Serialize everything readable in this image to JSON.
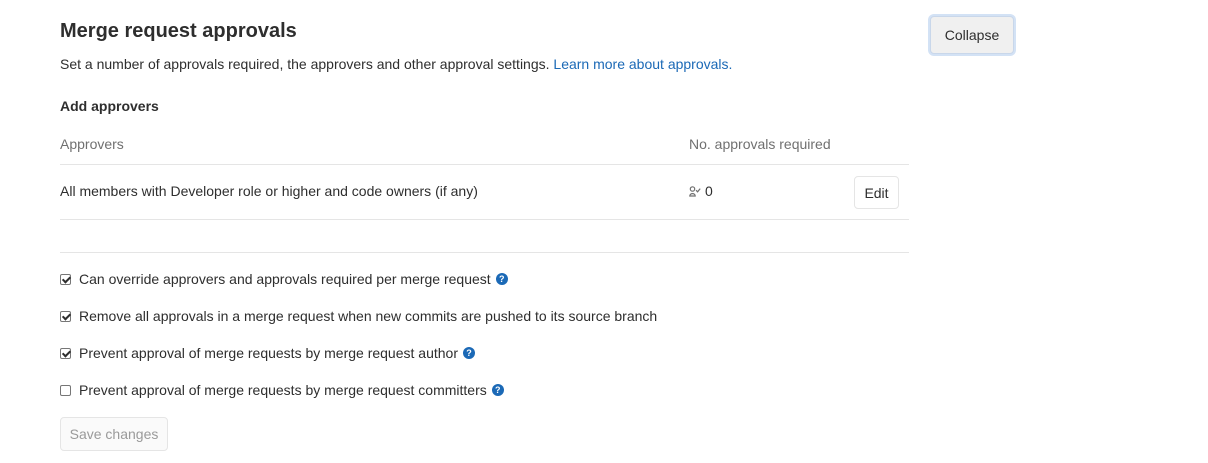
{
  "section": {
    "title": "Merge request approvals",
    "collapse_label": "Collapse",
    "description": "Set a number of approvals required, the approvers and other approval settings.",
    "learn_more_link": "Learn more about approvals."
  },
  "approvers": {
    "heading": "Add approvers",
    "columns": [
      "Approvers",
      "No. approvals required"
    ],
    "rows": [
      {
        "name": "All members with Developer role or higher and code owners (if any)",
        "icon": "approval-user-icon",
        "count": "0",
        "action_label": "Edit"
      }
    ]
  },
  "settings": {
    "options": [
      {
        "label": "Can override approvers and approvals required per merge request",
        "checked": true,
        "help": true
      },
      {
        "label": "Remove all approvals in a merge request when new commits are pushed to its source branch",
        "checked": true,
        "help": false
      },
      {
        "label": "Prevent approval of merge requests by merge request author",
        "checked": true,
        "help": true
      },
      {
        "label": "Prevent approval of merge requests by merge request committers",
        "checked": false,
        "help": true
      }
    ],
    "save_label": "Save changes"
  },
  "colors": {
    "link": "#1b69b6",
    "help_icon": "#1b69b6",
    "border": "#e5e5e5"
  }
}
